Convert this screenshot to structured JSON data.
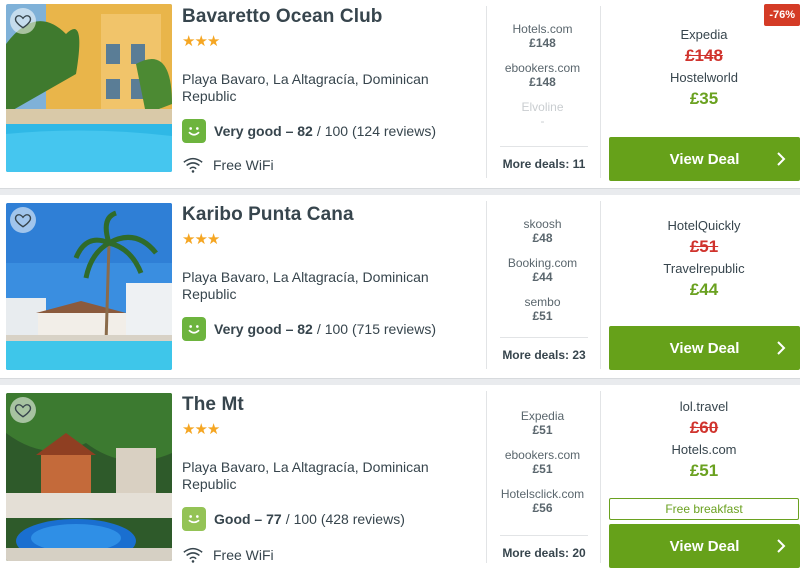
{
  "hotels": [
    {
      "name": "Bavaretto Ocean Club",
      "stars": "★★★",
      "address": "Playa Bavaro, La Altagracía, Dominican Republic",
      "rating_label": "Very good – 82",
      "rating_rest": "100 (124 reviews)",
      "wifi": "Free WiFi",
      "deals": [
        {
          "provider": "Hotels.com",
          "price": "£148"
        },
        {
          "provider": "ebookers.com",
          "price": "£148"
        },
        {
          "provider": "Elvoline",
          "price": "-"
        }
      ],
      "more_deals": "More deals: 11",
      "best": {
        "provider1": "Expedia",
        "old_price": "£148",
        "provider2": "Hostelworld",
        "new_price": "£35"
      },
      "discount": "-76%",
      "cta": "View Deal"
    },
    {
      "name": "Karibo Punta Cana",
      "stars": "★★★",
      "address": "Playa Bavaro, La Altagracía, Dominican Republic",
      "rating_label": "Very good – 82",
      "rating_rest": "100 (715 reviews)",
      "deals": [
        {
          "provider": "skoosh",
          "price": "£48"
        },
        {
          "provider": "Booking.com",
          "price": "£44"
        },
        {
          "provider": "sembo",
          "price": "£51"
        }
      ],
      "more_deals": "More deals: 23",
      "best": {
        "provider1": "HotelQuickly",
        "old_price": "£51",
        "provider2": "Travelrepublic",
        "new_price": "£44"
      },
      "cta": "View Deal"
    },
    {
      "name": "The Mt",
      "stars": "★★★",
      "address": "Playa Bavaro, La Altagracía, Dominican Republic",
      "rating_label": "Good – 77",
      "rating_rest": "100 (428 reviews)",
      "wifi": "Free WiFi",
      "deals": [
        {
          "provider": "Expedia",
          "price": "£51"
        },
        {
          "provider": "ebookers.com",
          "price": "£51"
        },
        {
          "provider": "Hotelsclick.com",
          "price": "£56"
        }
      ],
      "more_deals": "More deals: 20",
      "best": {
        "provider1": "lol.travel",
        "old_price": "£60",
        "provider2": "Hotels.com",
        "new_price": "£51"
      },
      "extra": "Free breakfast",
      "cta": "View Deal"
    }
  ],
  "colors": {
    "accent_green": "#66a11a",
    "price_red": "#d0332d",
    "star_orange": "#f5a623",
    "badge_red": "#d43b26"
  },
  "icons": [
    "heart-icon",
    "star-icon",
    "smiley-icon",
    "wifi-icon",
    "chevron-right-icon"
  ]
}
